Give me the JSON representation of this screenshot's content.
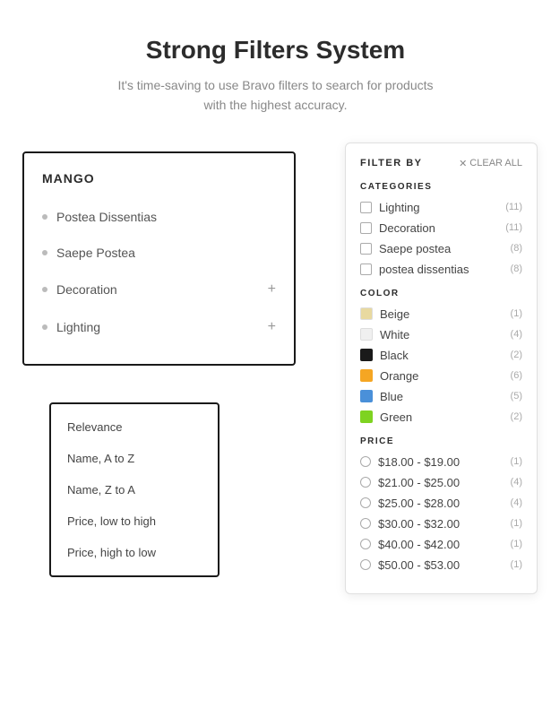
{
  "header": {
    "title": "Strong Filters System",
    "subtitle_line1": "It's time-saving to use Bravo filters to search for products",
    "subtitle_line2": "with the highest accuracy."
  },
  "left_panel": {
    "title": "MANGO",
    "items": [
      {
        "label": "Postea Dissentias",
        "has_plus": false
      },
      {
        "label": "Saepe Postea",
        "has_plus": false
      },
      {
        "label": "Decoration",
        "has_plus": true
      },
      {
        "label": "Lighting",
        "has_plus": true
      }
    ]
  },
  "sort_panel": {
    "items": [
      {
        "label": "Relevance"
      },
      {
        "label": "Name, A to Z"
      },
      {
        "label": "Name, Z to A"
      },
      {
        "label": "Price, low to high"
      },
      {
        "label": "Price, high to low"
      }
    ]
  },
  "filter_panel": {
    "header_label": "FILTER BY",
    "clear_all": "CLEAR ALL",
    "sections": {
      "categories": {
        "title": "CATEGORIES",
        "items": [
          {
            "label": "Lighting",
            "count": "(11)"
          },
          {
            "label": "Decoration",
            "count": "(11)"
          },
          {
            "label": "Saepe postea",
            "count": "(8)"
          },
          {
            "label": "postea dissentias",
            "count": "(8)"
          }
        ]
      },
      "color": {
        "title": "COLOR",
        "items": [
          {
            "label": "Beige",
            "color": "#e8d9a0",
            "count": "(1)"
          },
          {
            "label": "White",
            "color": "#f0f0f0",
            "count": "(4)"
          },
          {
            "label": "Black",
            "color": "#1a1a1a",
            "count": "(2)"
          },
          {
            "label": "Orange",
            "color": "#f5a623",
            "count": "(6)"
          },
          {
            "label": "Blue",
            "color": "#4a90d9",
            "count": "(5)"
          },
          {
            "label": "Green",
            "color": "#7ed321",
            "count": "(2)"
          }
        ]
      },
      "price": {
        "title": "PRICE",
        "items": [
          {
            "label": "$18.00 - $19.00",
            "count": "(1)"
          },
          {
            "label": "$21.00 - $25.00",
            "count": "(4)"
          },
          {
            "label": "$25.00 - $28.00",
            "count": "(4)"
          },
          {
            "label": "$30.00 - $32.00",
            "count": "(1)"
          },
          {
            "label": "$40.00 - $42.00",
            "count": "(1)"
          },
          {
            "label": "$50.00 - $53.00",
            "count": "(1)"
          }
        ]
      }
    }
  }
}
